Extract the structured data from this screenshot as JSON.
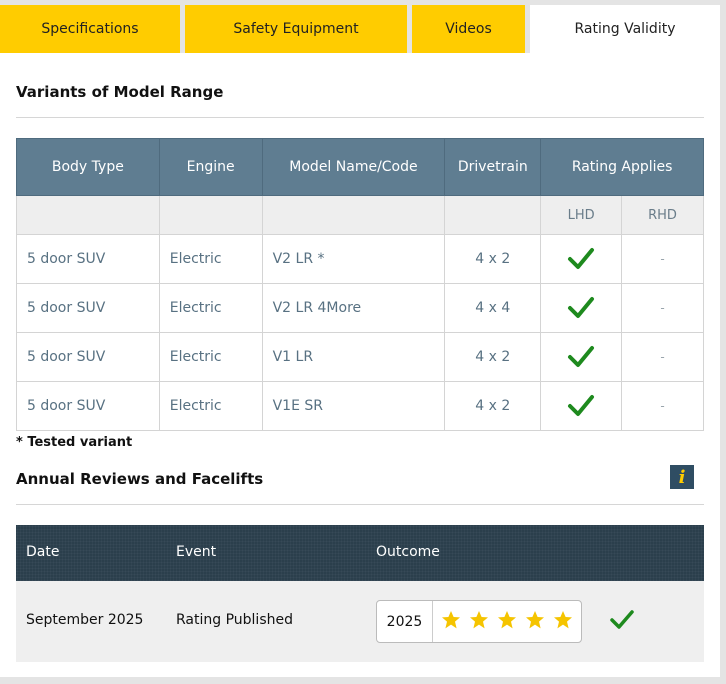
{
  "tabs": [
    {
      "label": "Specifications",
      "active": false
    },
    {
      "label": "Safety Equipment",
      "active": false
    },
    {
      "label": "Videos",
      "active": false
    },
    {
      "label": "Rating Validity",
      "active": true
    }
  ],
  "variants": {
    "title": "Variants of Model Range",
    "headers": [
      "Body Type",
      "Engine",
      "Model Name/Code",
      "Drivetrain",
      "Rating Applies"
    ],
    "subheaders": [
      "LHD",
      "RHD"
    ],
    "rows": [
      {
        "body": "5 door SUV",
        "engine": "Electric",
        "model": "V2 LR *",
        "drivetrain": "4 x 2",
        "lhd": "check-icon",
        "rhd": "-"
      },
      {
        "body": "5 door SUV",
        "engine": "Electric",
        "model": "V2 LR 4More",
        "drivetrain": "4 x 4",
        "lhd": "check-icon",
        "rhd": "-"
      },
      {
        "body": "5 door SUV",
        "engine": "Electric",
        "model": "V1 LR",
        "drivetrain": "4 x 2",
        "lhd": "check-icon",
        "rhd": "-"
      },
      {
        "body": "5 door SUV",
        "engine": "Electric",
        "model": "V1E SR",
        "drivetrain": "4 x 2",
        "lhd": "check-icon",
        "rhd": "-"
      }
    ],
    "footnote": "* Tested variant"
  },
  "reviews": {
    "title": "Annual Reviews and Facelifts",
    "info_icon": "i",
    "headers": {
      "date": "Date",
      "event": "Event",
      "outcome": "Outcome"
    },
    "rows": [
      {
        "date": "September 2025",
        "event": "Rating Published",
        "year": "2025",
        "stars": 5,
        "status_icon": "check-icon"
      }
    ]
  },
  "colors": {
    "tab_yellow": "#ffcc00",
    "table_header": "#5f7d91",
    "review_header": "#2b3f4c",
    "check_green": "#1e8a1e",
    "star_yellow": "#f5c400"
  }
}
